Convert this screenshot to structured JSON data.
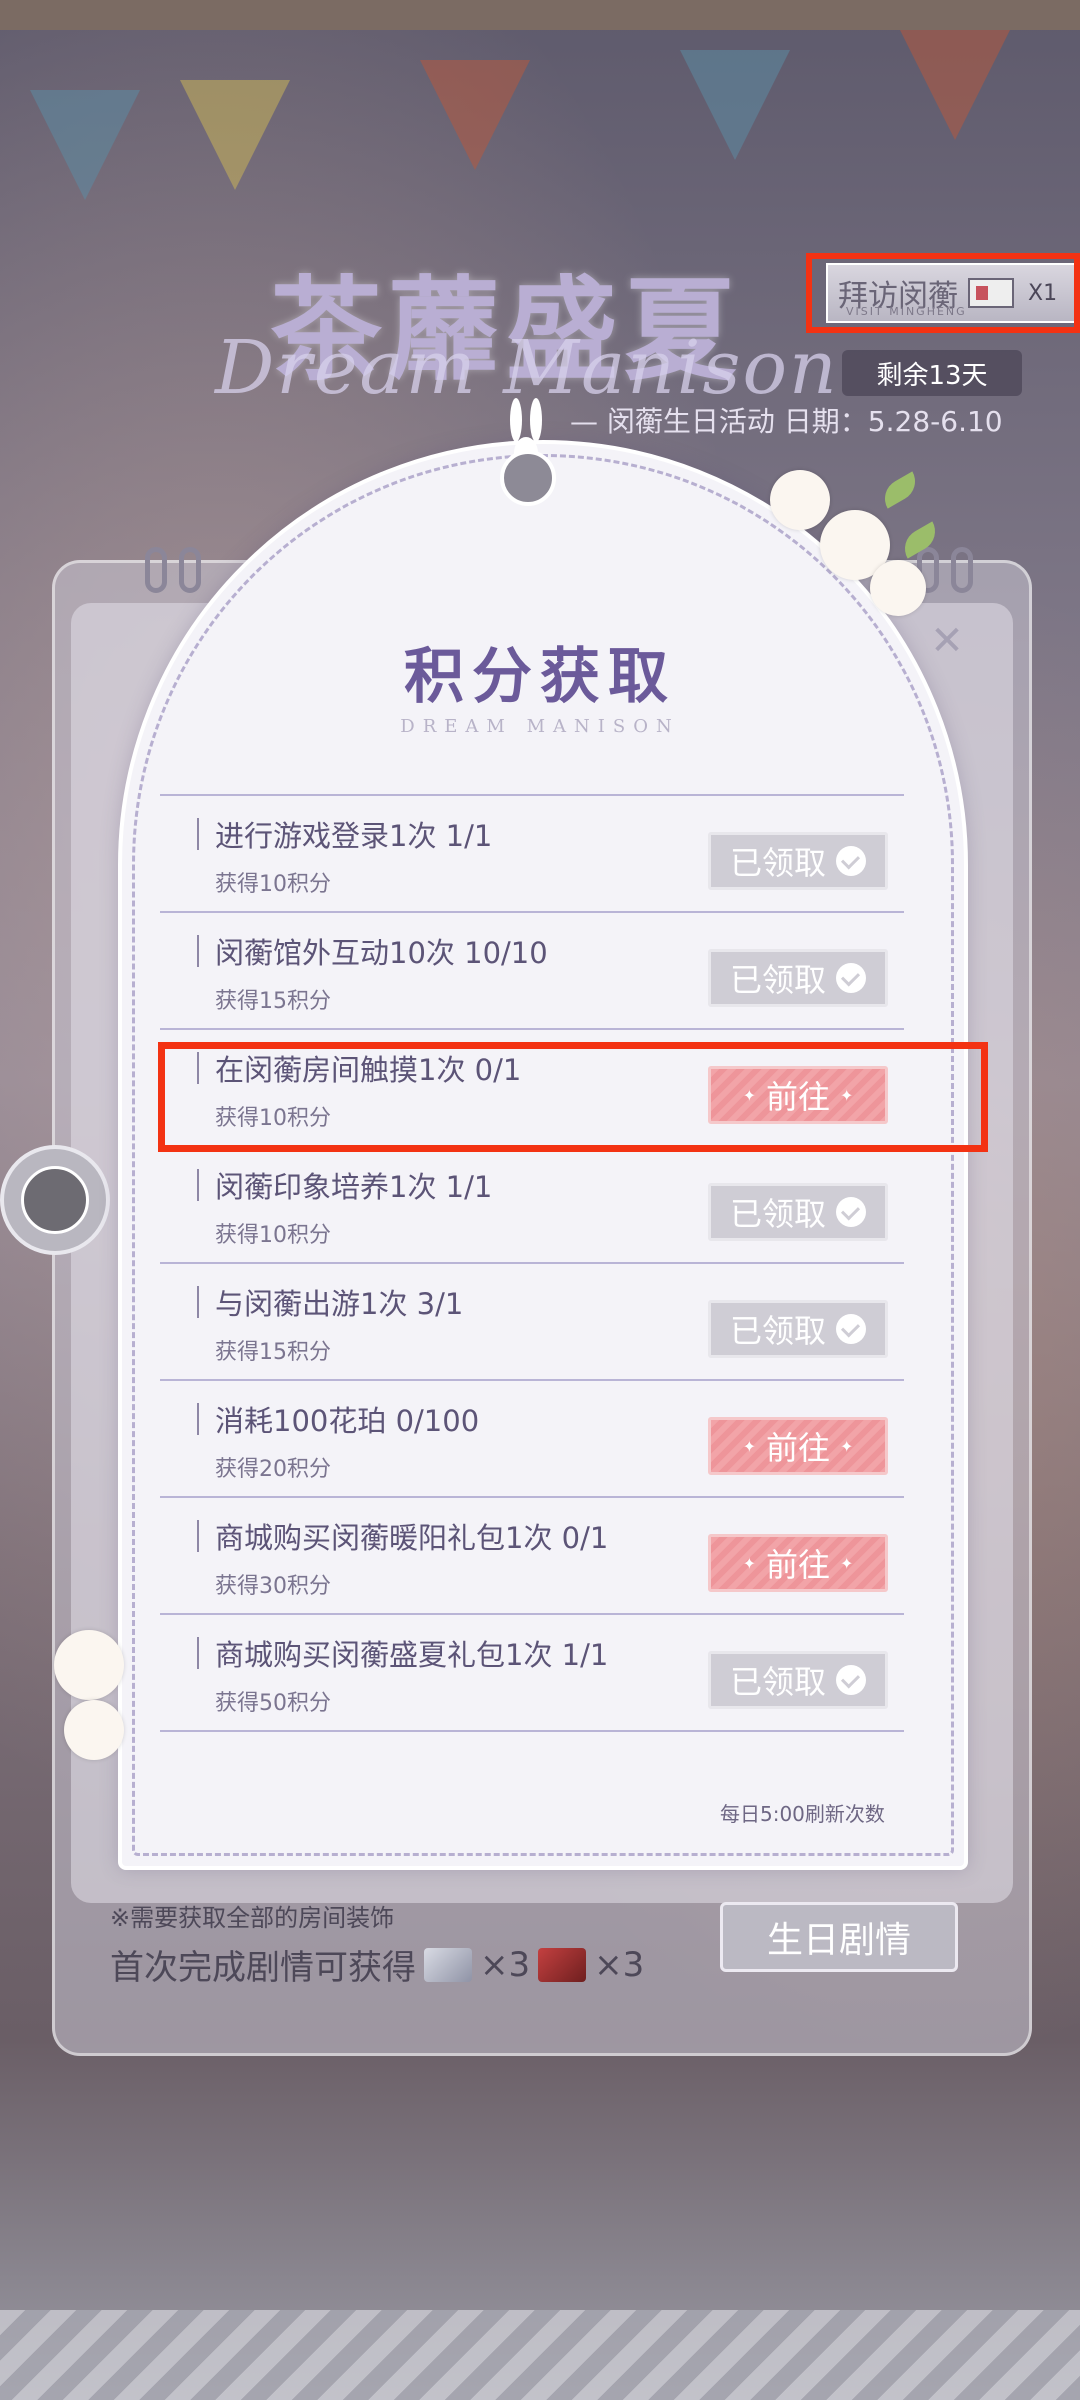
{
  "header": {
    "title": "茶蘼盛夏",
    "subtitle": "Dream Manison",
    "visit_ticket": {
      "label": "拜访闵蘅",
      "sub": "VISIT MINGHENG",
      "icon": "ticket-icon",
      "count": "X1"
    },
    "remaining": "剩余13天",
    "event_info": "— 闵蘅生日活动  日期：5.28-6.10"
  },
  "panel": {
    "title": "积分获取",
    "subtitle": "DREAM MANISON",
    "tasks": [
      {
        "title": "进行游戏登录1次 1/1",
        "points": "获得10积分",
        "button": "已领取",
        "state": "claimed"
      },
      {
        "title": "闵蘅馆外互动10次 10/10",
        "points": "获得15积分",
        "button": "已领取",
        "state": "claimed"
      },
      {
        "title": "在闵蘅房间触摸1次 0/1",
        "points": "获得10积分",
        "button": "前往",
        "state": "go"
      },
      {
        "title": "闵蘅印象培养1次 1/1",
        "points": "获得10积分",
        "button": "已领取",
        "state": "claimed"
      },
      {
        "title": "与闵蘅出游1次 3/1",
        "points": "获得15积分",
        "button": "已领取",
        "state": "claimed"
      },
      {
        "title": "消耗100花珀 0/100",
        "points": "获得20积分",
        "button": "前往",
        "state": "go"
      },
      {
        "title": "商城购买闵蘅暖阳礼包1次 0/1",
        "points": "获得30积分",
        "button": "前往",
        "state": "go"
      },
      {
        "title": "商城购买闵蘅盛夏礼包1次 1/1",
        "points": "获得50积分",
        "button": "已领取",
        "state": "claimed"
      }
    ],
    "refresh_note": "每日5:00刷新次数"
  },
  "bottom": {
    "note": "※需要获取全部的房间装饰",
    "reward_prefix": "首次完成剧情可获得",
    "reward_1": "×3",
    "reward_2": "×3",
    "story_button": "生日剧情"
  },
  "colors": {
    "title": "#6b5a9a",
    "claimed": "#cfcdd5",
    "go": "#f2a4a8",
    "highlight": "#f33213"
  }
}
